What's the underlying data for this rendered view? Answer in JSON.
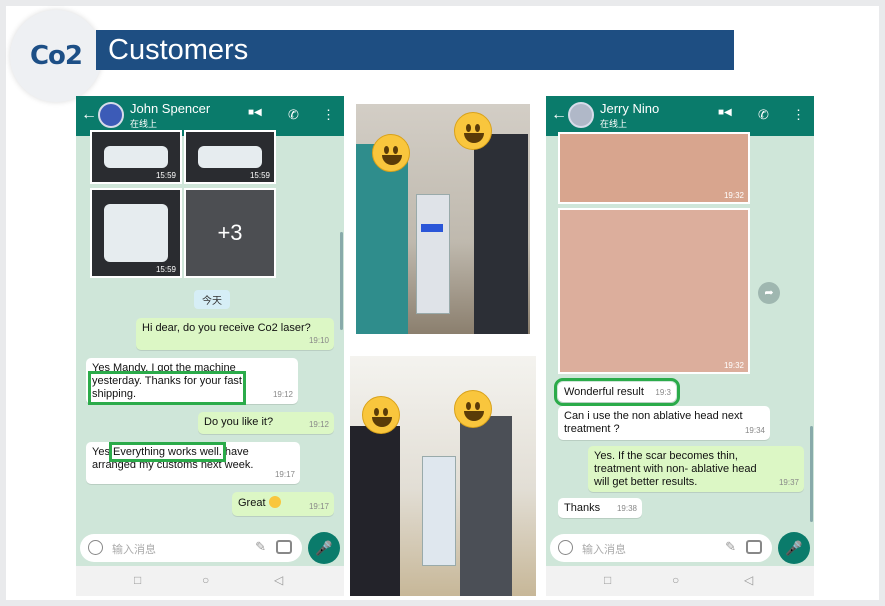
{
  "header": {
    "logo": "Co2",
    "title": "Customers"
  },
  "left_chat": {
    "contact_name": "John Spencer",
    "contact_status": "在线上",
    "thumb_times": [
      "15:59",
      "15:59",
      "15:59"
    ],
    "more_count": "+3",
    "day_label": "今天",
    "messages": [
      {
        "text": "Hi dear, do you receive Co2 laser?",
        "time": "19:10"
      },
      {
        "text_a": "Yes Mandy. I got the machine",
        "text_b": "yesterday. Thanks for your fast",
        "text_c": "shipping.",
        "time": "19:12"
      },
      {
        "text": "Do you like it?",
        "time": "19:12"
      },
      {
        "text_a": "Yes",
        "text_b": "Everything works well.",
        "text_c": "have",
        "text_d": "arranged my customs next week.",
        "time": "19:17"
      },
      {
        "text": "Great",
        "time": "19:17"
      }
    ],
    "input_placeholder": "输入消息"
  },
  "right_chat": {
    "contact_name": "Jerry Nino",
    "contact_status": "在线上",
    "photo_times": [
      "19:32",
      "19:32"
    ],
    "messages": [
      {
        "text": "Wonderful result",
        "time": "19:3"
      },
      {
        "text_a": "Can i use the non ablative head next",
        "text_b": "treatment ?",
        "time": "19:34"
      },
      {
        "text_a": "Yes.  If the scar becomes thin,",
        "text_b": "treatment with non- ablative head",
        "text_c": "will get better results.",
        "time": "19:37"
      },
      {
        "text": "Thanks",
        "time": "19:38"
      }
    ],
    "input_placeholder": "输入消息"
  },
  "icons": {
    "back": "←",
    "video": "■◀",
    "call": "✆",
    "menu": "⋮",
    "clip": "✎",
    "mic": "🎤",
    "nav_square": "□",
    "nav_circle": "○",
    "nav_back": "◁",
    "forward": "➦"
  },
  "colors": {
    "brand": "#1e4e82",
    "whatsapp": "#0a7b6b",
    "highlight": "#2bab4a"
  }
}
